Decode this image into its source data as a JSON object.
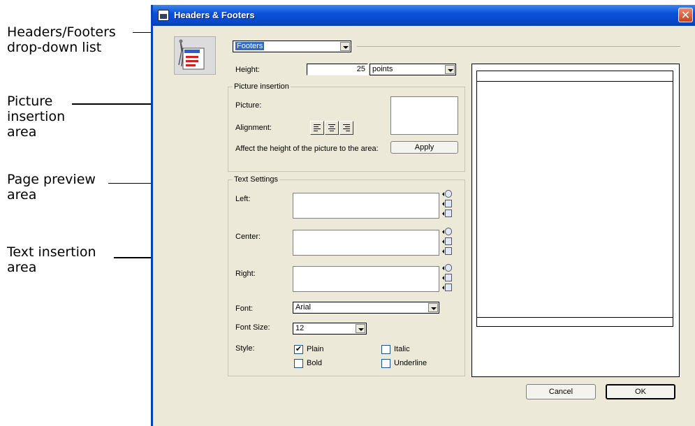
{
  "callouts": {
    "headers_footers": "Headers/Footers\n drop-down list",
    "picture_insertion": "Picture\ninsertion\narea",
    "page_preview": "Page preview\narea",
    "text_insertion": "Text insertion\narea"
  },
  "window": {
    "title": "Headers & Footers",
    "close_glyph": "✕"
  },
  "section_select": {
    "value": "Footers"
  },
  "height": {
    "label": "Height:",
    "value": "25",
    "unit": "points"
  },
  "picture": {
    "group_title": "Picture insertion",
    "picture_label": "Picture:",
    "alignment_label": "Alignment:",
    "affect_label": "Affect the height of the picture to the area:",
    "apply_label": "Apply"
  },
  "text": {
    "group_title": "Text Settings",
    "left_label": "Left:",
    "center_label": "Center:",
    "right_label": "Right:",
    "font_label": "Font:",
    "font_value": "Arial",
    "font_size_label": "Font Size:",
    "font_size_value": "12",
    "style_label": "Style:",
    "style": {
      "plain": "Plain",
      "italic": "Italic",
      "bold": "Bold",
      "underline": "Underline"
    },
    "style_checked": {
      "plain": true,
      "italic": false,
      "bold": false,
      "underline": false
    }
  },
  "buttons": {
    "cancel": "Cancel",
    "ok": "OK"
  }
}
